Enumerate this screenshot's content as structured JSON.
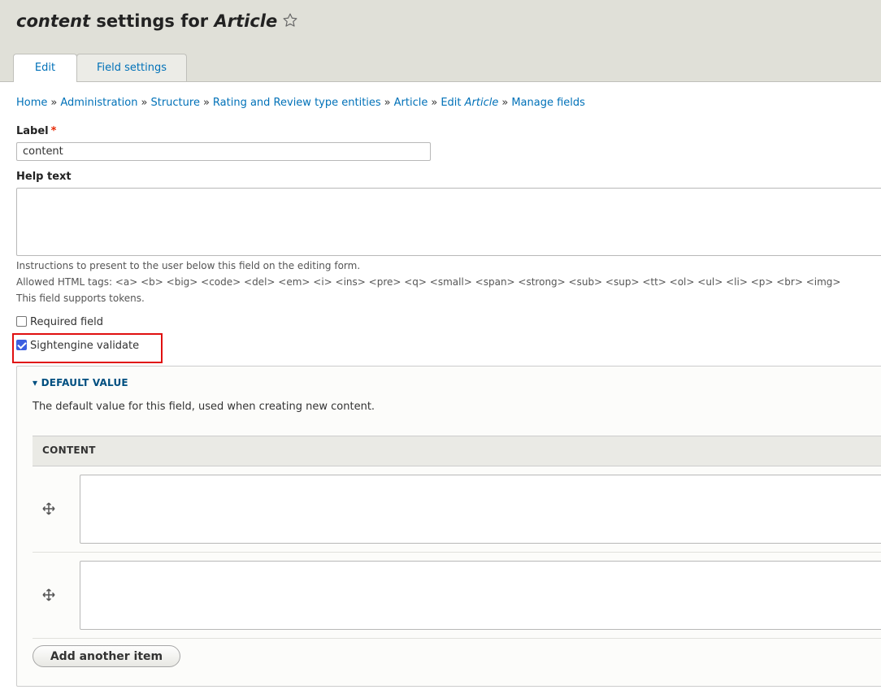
{
  "header": {
    "title_field": "content",
    "title_mid": " settings for ",
    "title_entity": "Article",
    "star_icon": "star-outline-icon"
  },
  "tabs": [
    {
      "label": "Edit",
      "active": true
    },
    {
      "label": "Field settings",
      "active": false
    }
  ],
  "breadcrumb": {
    "items": [
      "Home",
      "Administration",
      "Structure",
      "Rating and Review type entities",
      "Article"
    ],
    "edit_prefix": "Edit ",
    "edit_entity": "Article",
    "last": "Manage fields",
    "separator": "»"
  },
  "form": {
    "label_title": "Label",
    "required_marker": "*",
    "label_value": "content",
    "help_title": "Help text",
    "help_value": "",
    "help_desc_1": "Instructions to present to the user below this field on the editing form.",
    "help_desc_2": "Allowed HTML tags: <a> <b> <big> <code> <del> <em> <i> <ins> <pre> <q> <small> <span> <strong> <sub> <sup> <tt> <ol> <ul> <li> <p> <br> <img>",
    "help_desc_3": "This field supports tokens.",
    "required_label": "Required field",
    "required_checked": false,
    "sightengine_label": "Sightengine validate",
    "sightengine_checked": true
  },
  "default_value": {
    "summary": "▾ DEFAULT VALUE",
    "description": "The default value for this field, used when creating new content.",
    "column_header": "CONTENT",
    "items": [
      "",
      ""
    ],
    "add_button": "Add another item"
  },
  "colors": {
    "link": "#0071b8",
    "highlight": "#e01010",
    "checkbox": "#3d5fe0"
  }
}
